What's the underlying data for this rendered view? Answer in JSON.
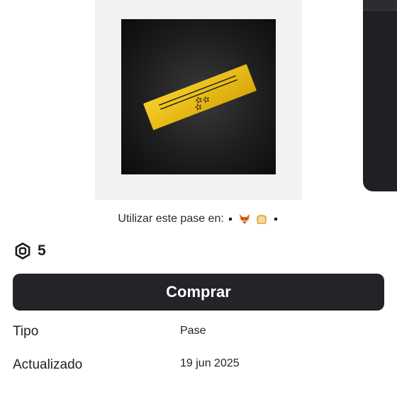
{
  "usage": {
    "prefix": "Utilizar este pase en:"
  },
  "icons": {
    "robux": "robux-icon",
    "fox": "fox-emoji-icon",
    "bread": "bread-emoji-icon"
  },
  "price": {
    "amount": "5"
  },
  "buy": {
    "label": "Comprar"
  },
  "details": {
    "type_label": "Tipo",
    "type_value": "Pase",
    "updated_label": "Actualizado",
    "updated_value": "19 jun 2025"
  },
  "colors": {
    "button_bg": "#232427",
    "ticket_gold": "#e8b90f",
    "thumb_bg": "#f2f2f2"
  }
}
